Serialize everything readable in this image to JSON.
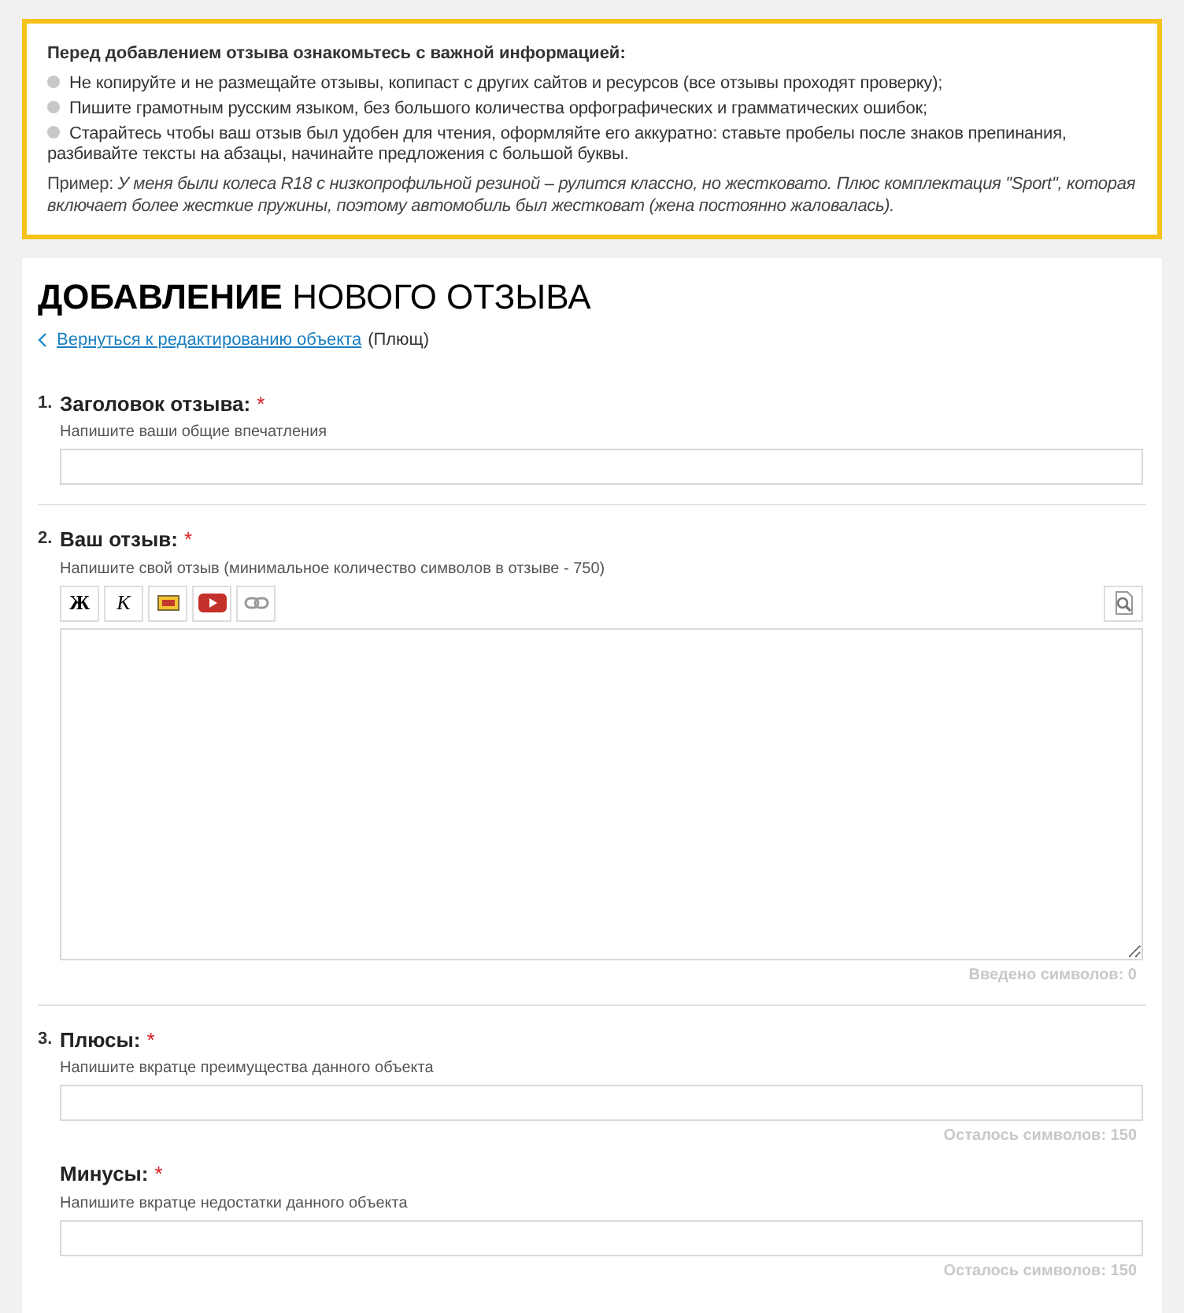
{
  "notice": {
    "title": "Перед добавлением отзыва ознакомьтесь с важной информацией:",
    "items": [
      "Не копируйте и не размещайте отзывы, копипаст с других сайтов и ресурсов (все отзывы проходят проверку);",
      "Пишите грамотным русским языком, без большого количества орфографических и грамматических ошибок;",
      "Старайтесь чтобы ваш отзыв был удобен для чтения, оформляйте его аккуратно: ставьте пробелы после знаков препинания, разбивайте тексты на абзацы, начинайте предложения с большой буквы."
    ],
    "example": "Пример: *У меня были колеса R18 с низкопрофильной резиной – рулится классно, но жестковато. Плюс комплектация \"Sport\", которая включает более жесткие пружины, поэтому автомобиль был жестковат (жена постоянно жаловалась).*"
  },
  "heading": {
    "bold": "ДОБАВЛЕНИЕ",
    "rest": "НОВОГО ОТЗЫВА"
  },
  "back_link": {
    "label": "Вернуться к редактированию объекта",
    "note": "(Плющ)"
  },
  "sections": [
    {
      "number": "1.",
      "fields": [
        {
          "kind": "input",
          "label": "Заголовок отзыва:",
          "required_mark": "*",
          "hint": "Напишите ваши общие впечатления"
        }
      ]
    },
    {
      "number": "2.",
      "fields": [
        {
          "kind": "editor",
          "label": "Ваш отзыв:",
          "required_mark": "*",
          "hint": "Напишите свой отзыв (минимальное количество символов в отзыве - 750)",
          "toolbar": [
            {
              "kind": "text",
              "label": "Ж"
            },
            {
              "kind": "text",
              "label": "К"
            },
            {
              "kind": "image"
            },
            {
              "kind": "video"
            },
            {
              "kind": "link"
            }
          ],
          "counter": "Введено символов: 0"
        }
      ]
    },
    {
      "number": "3.",
      "fields": [
        {
          "kind": "input",
          "label": "Плюсы:",
          "required_mark": "*",
          "hint": "Напишите вкратце преимущества данного объекта",
          "counter": "Осталось символов: 150"
        },
        {
          "kind": "input",
          "label": "Минусы:",
          "required_mark": "*",
          "hint": "Напишите вкратце недостатки данного объекта",
          "counter": "Осталось символов: 150"
        }
      ]
    }
  ]
}
